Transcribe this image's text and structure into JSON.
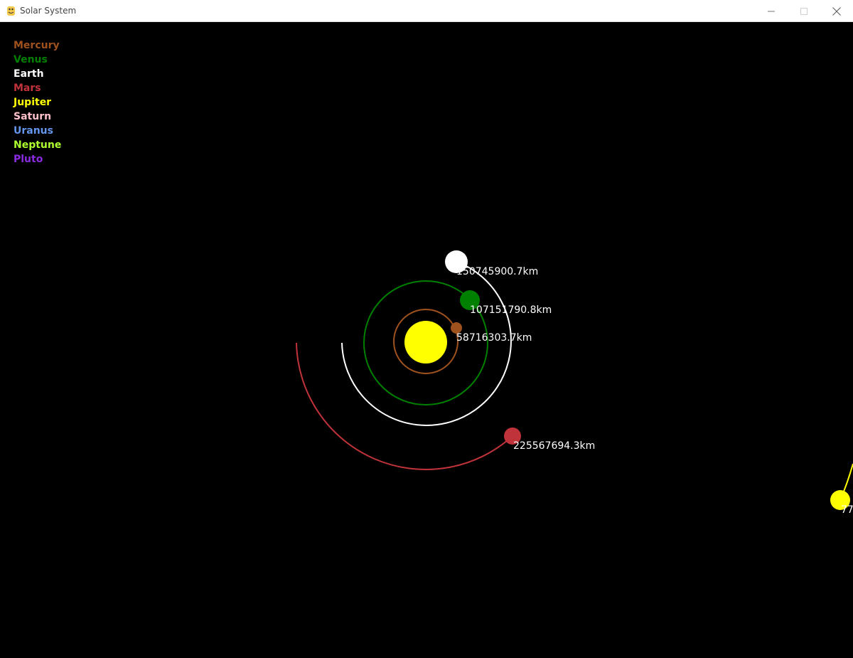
{
  "window": {
    "title": "Solar System",
    "app_icon": "pygame-snake-icon",
    "controls": {
      "minimize": "minimize-icon",
      "maximize": "maximize-icon",
      "close": "close-icon"
    }
  },
  "legend": [
    {
      "name": "Mercury",
      "color": "#A0521E"
    },
    {
      "name": "Venus",
      "color": "#008000"
    },
    {
      "name": "Earth",
      "color": "#FFFFFF"
    },
    {
      "name": "Mars",
      "color": "#C0333A"
    },
    {
      "name": "Jupiter",
      "color": "#FFFF00"
    },
    {
      "name": "Saturn",
      "color": "#FFC0CB"
    },
    {
      "name": "Uranus",
      "color": "#6495ED"
    },
    {
      "name": "Neptune",
      "color": "#ADFF2F"
    },
    {
      "name": "Pluto",
      "color": "#8A2BE2"
    }
  ],
  "sun": {
    "color": "#FFFF00"
  },
  "planets": [
    {
      "name": "Mercury",
      "color": "#A0521E",
      "distance_label": "58716303.7km"
    },
    {
      "name": "Venus",
      "color": "#008000",
      "distance_label": "107151790.8km"
    },
    {
      "name": "Earth",
      "color": "#FFFFFF",
      "distance_label": "150745900.7km"
    },
    {
      "name": "Mars",
      "color": "#C0333A",
      "distance_label": "225567694.3km"
    },
    {
      "name": "Jupiter",
      "color": "#FFFF00",
      "distance_label": "77"
    }
  ]
}
